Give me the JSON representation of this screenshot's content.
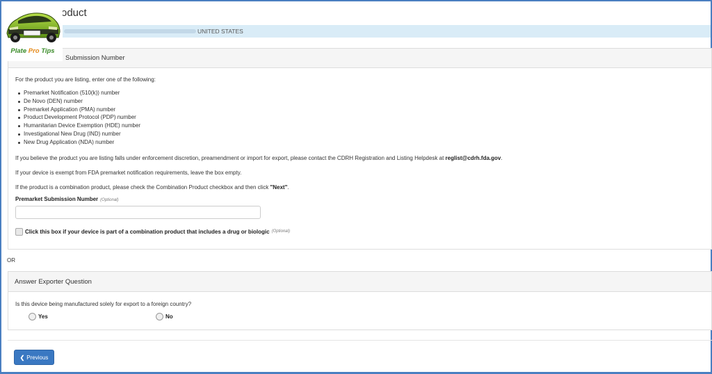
{
  "header": {
    "title": "oduct",
    "logo_text_1": "Plate ",
    "logo_text_2": "Pro",
    "logo_text_3": " Tips",
    "country": "UNITED STATES"
  },
  "premarket_panel": {
    "heading": "Submission Number",
    "intro": "For the product you are listing, enter one of the following:",
    "options": [
      "Premarket Notification (510(k)) number",
      "De Novo (DEN) number",
      "Premarket Application (PMA) number",
      "Product Development Protocol (PDP) number",
      "Humanitarian Device Exemption (HDE) number",
      "Investigational New Drug (IND) number",
      "New Drug Application (NDA) number"
    ],
    "para1_text": "If you believe the product you are listing falls under enforcement discretion, preamendment or import for export, please contact the CDRH Registration and Listing Helpdesk at ",
    "para1_email": "reglist@cdrh.fda.gov",
    "para1_end": ".",
    "para2": "If your device is exempt from FDA premarket notification requirements, leave the box empty.",
    "para3_text": "If the product is a combination product, please check the Combination Product checkbox and then click ",
    "para3_next": "\"Next\"",
    "para3_end": ".",
    "field_label": "Premarket Submission Number",
    "field_optional": "(Optional)",
    "field_value": "",
    "checkbox_label": "Click this box if your device is part of a combination product that includes a drug or biologic",
    "checkbox_optional": "(Optional)"
  },
  "or_label": "OR",
  "exporter_panel": {
    "heading": "Answer Exporter Question",
    "question": "Is this device being manufactured solely for export to a foreign country?",
    "yes_label": "Yes",
    "no_label": "No"
  },
  "footer": {
    "previous_label": "Previous"
  }
}
